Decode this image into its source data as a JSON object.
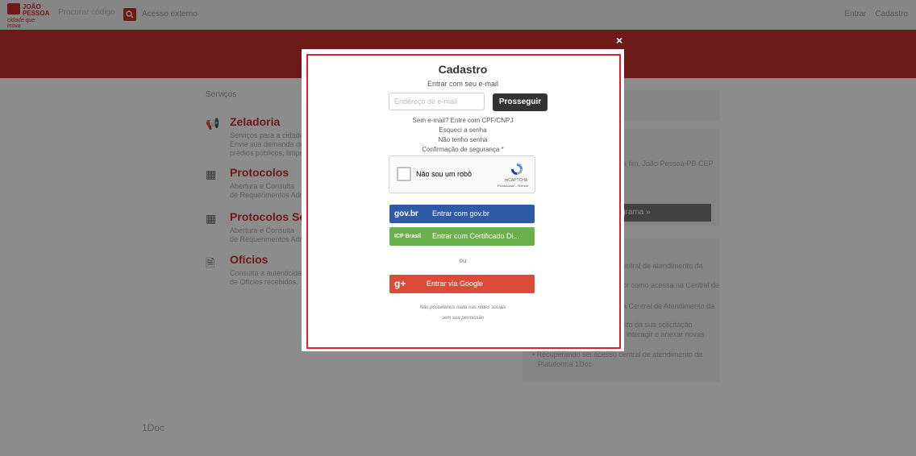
{
  "header": {
    "search_placeholder": "Procurar código",
    "advanced_link": "Acesso externo",
    "right_links": [
      "Entrar",
      "Cadastro"
    ],
    "logo_line1": "JOÃO",
    "logo_line2": "PESSOA",
    "logo_tag": "cidade que inova"
  },
  "page": {
    "breadcrumb": "Serviços",
    "services": [
      {
        "title": "Zeladoria",
        "desc": [
          "Serviços para a cidade.",
          "Envie sua demanda de co",
          "prédios públicos, limpeza"
        ]
      },
      {
        "title": "Protocolos",
        "desc": [
          "Abertura e Consulta",
          "de Requerimentos Admini"
        ]
      },
      {
        "title": "Protocolos Serv",
        "desc": [
          "Abertura e Consulta",
          "de Requerimentos Admini"
        ]
      },
      {
        "title": "Ofícios",
        "desc": [
          "Consulta a autenticidade",
          "de Ofícios recebidos."
        ]
      }
    ],
    "right_text1": "a fim, João Pessoa-PB CEP",
    "right_button": "grama »",
    "right_list": [
      "entral de atendimento da",
      "or como acessa na Central de",
      "a Central de Atendimento da",
      "nto da sua solicitação",
      ", interagir e anexar novas",
      "• Recuperando sei acesso central de atendimento da",
      "Plataforma 1Doc"
    ],
    "footer_brand": "1Doc"
  },
  "modal": {
    "close": "×",
    "title": "Cadastro",
    "subtitle": "Entrar com seu e-mail",
    "email_placeholder": "Endereço de e-mail",
    "next_button": "Prosseguir",
    "link_no_email": "Sem e-mail? Entre com CPF/CNPJ",
    "link_forgot": "Esqueci a senha",
    "link_no_password": "Não tenho senha",
    "security_label": "Confirmação de segurança",
    "security_required": "*",
    "recaptcha": {
      "label": "Não sou um robô",
      "brand": "reCAPTCHA",
      "terms": "Privacidade - Termos"
    },
    "govbr": {
      "icon": "gov.br",
      "label": "Entrar com gov.br"
    },
    "certificate": {
      "icon": "ICP Brasil",
      "label": "Entrar com Certificado Di..."
    },
    "or": "ou",
    "google": {
      "icon": "g+",
      "label": "Entrar via Google"
    },
    "note_line1": "Não postaremos nada nas redes sociais",
    "note_line2": "sem sua permissão",
    "colors": {
      "govbr": "#2f5ba6",
      "cert": "#6ab04c",
      "google": "#dc4a38",
      "border": "#e0202a"
    }
  }
}
